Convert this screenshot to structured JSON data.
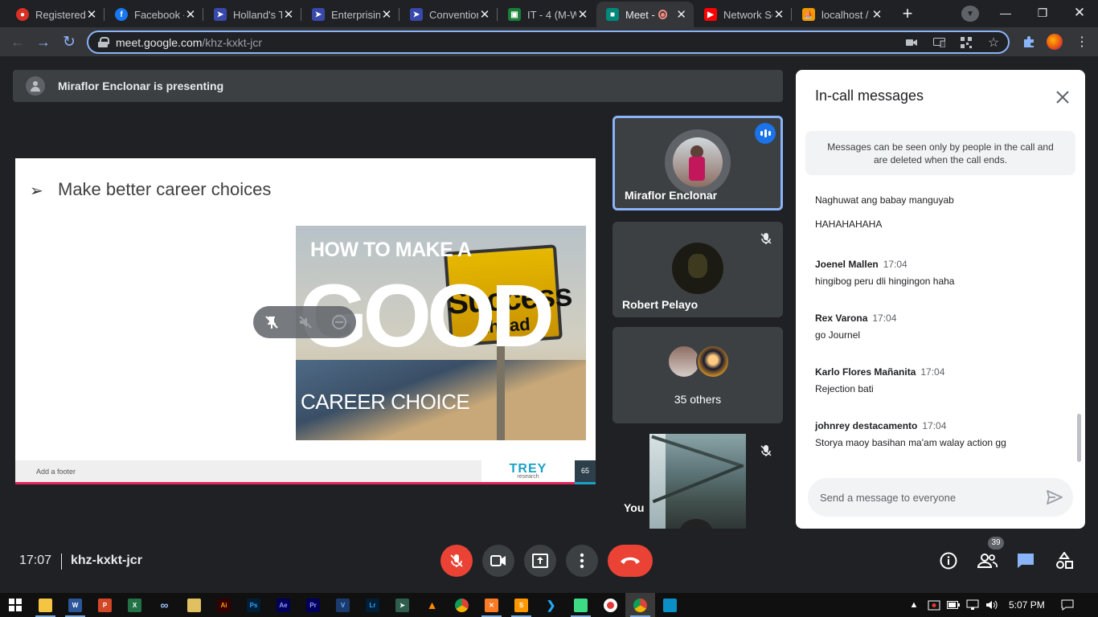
{
  "browser": {
    "tabs": [
      {
        "title": "Registered",
        "favicon_color": "#d93025",
        "active": false
      },
      {
        "title": "Facebook -",
        "favicon_color": "#1877f2",
        "active": false
      },
      {
        "title": "Holland's T",
        "favicon_color": "#3949ab",
        "active": false
      },
      {
        "title": "Enterprisin",
        "favicon_color": "#3949ab",
        "active": false
      },
      {
        "title": "Convention",
        "favicon_color": "#3949ab",
        "active": false
      },
      {
        "title": "IT - 4 (M-W",
        "favicon_color": "#188038",
        "active": false
      },
      {
        "title": "Meet -",
        "favicon_color": "#00897b",
        "active": true
      },
      {
        "title": "Network Se",
        "favicon_color": "#ff0000",
        "active": false
      },
      {
        "title": "localhost /",
        "favicon_color": "#f29900",
        "active": false
      }
    ],
    "url_host": "meet.google.com",
    "url_path": "/khz-kxkt-jcr"
  },
  "meet": {
    "presenting_banner": "Miraflor Enclonar is presenting",
    "slide": {
      "heading": "Make better career choices",
      "image_text": {
        "line1": "HOW TO MAKE A",
        "line2": "GOOD",
        "line3": "CAREER CHOICE",
        "sign1": "Success",
        "sign2": "Ahead"
      },
      "footer": "Add a footer",
      "brand": "TREY",
      "brand_sub": "research",
      "page_number": "65"
    },
    "participants": [
      {
        "name": "Miraflor Enclonar",
        "speaking": true
      },
      {
        "name": "Robert Pelayo",
        "muted": true
      },
      {
        "label": "35 others"
      },
      {
        "name": "You",
        "muted": true
      }
    ],
    "chat": {
      "title": "In-call messages",
      "notice": "Messages can be seen only by people in the call and are deleted when the call ends.",
      "messages": [
        {
          "sender": "",
          "time": "",
          "text": "Naghuwat ang babay manguyab"
        },
        {
          "sender": "",
          "time": "",
          "text": "HAHAHAHAHA"
        },
        {
          "sender": "Joenel Mallen",
          "time": "17:04",
          "text": "hingibog peru dli hingingon haha"
        },
        {
          "sender": "Rex Varona",
          "time": "17:04",
          "text": "go Journel"
        },
        {
          "sender": "Karlo Flores Mañanita",
          "time": "17:04",
          "text": "Rejection bati"
        },
        {
          "sender": "johnrey destacamento",
          "time": "17:04",
          "text": "Storya maoy basihan ma'am walay action gg"
        }
      ],
      "input_placeholder": "Send a message to everyone"
    },
    "bottom_bar": {
      "time": "17:07",
      "meeting_code": "khz-kxkt-jcr",
      "people_count": "39"
    }
  },
  "taskbar": {
    "apps": [
      "file-explorer",
      "word",
      "powerpoint",
      "excel",
      "infinity",
      "ae-tool",
      "illustrator",
      "photoshop",
      "after-effects",
      "premiere",
      "visio",
      "lightroom",
      "sublime-arrow",
      "vlc",
      "chrome",
      "xampp",
      "sublime-text",
      "vscode",
      "android-studio",
      "recorder",
      "chrome-active",
      "photos"
    ],
    "clock": "5:07 PM"
  },
  "colors": {
    "accent_blue": "#8ab4f8",
    "meet_red": "#ea4335",
    "speaking_blue": "#1a73e8",
    "dark_bg": "#202124",
    "tile_bg": "#3c4043"
  }
}
